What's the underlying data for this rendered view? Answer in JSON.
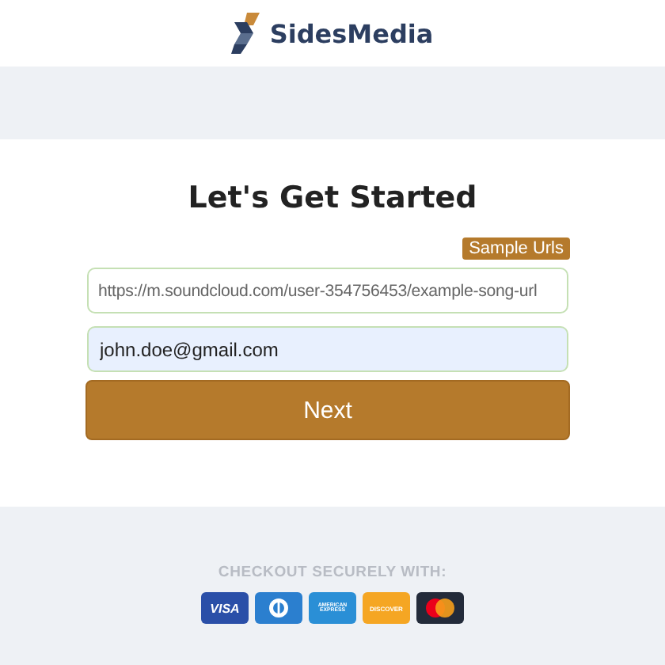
{
  "header": {
    "brand": "SidesMedia"
  },
  "form": {
    "title": "Let's Get Started",
    "sample_button": "Sample Urls",
    "url_field": {
      "placeholder": "https://m.soundcloud.com/user-354756453/example-song-url"
    },
    "email_field": {
      "value": "john.doe@gmail.com"
    },
    "submit": "Next"
  },
  "footer": {
    "caption": "CHECKOUT SECURELY WITH:",
    "cards": [
      {
        "kind": "visa",
        "label": "VISA"
      },
      {
        "kind": "diners"
      },
      {
        "kind": "amex",
        "label": "AMERICAN EXPRESS"
      },
      {
        "kind": "discover",
        "label": "DISCOVER"
      },
      {
        "kind": "mastercard"
      }
    ]
  }
}
